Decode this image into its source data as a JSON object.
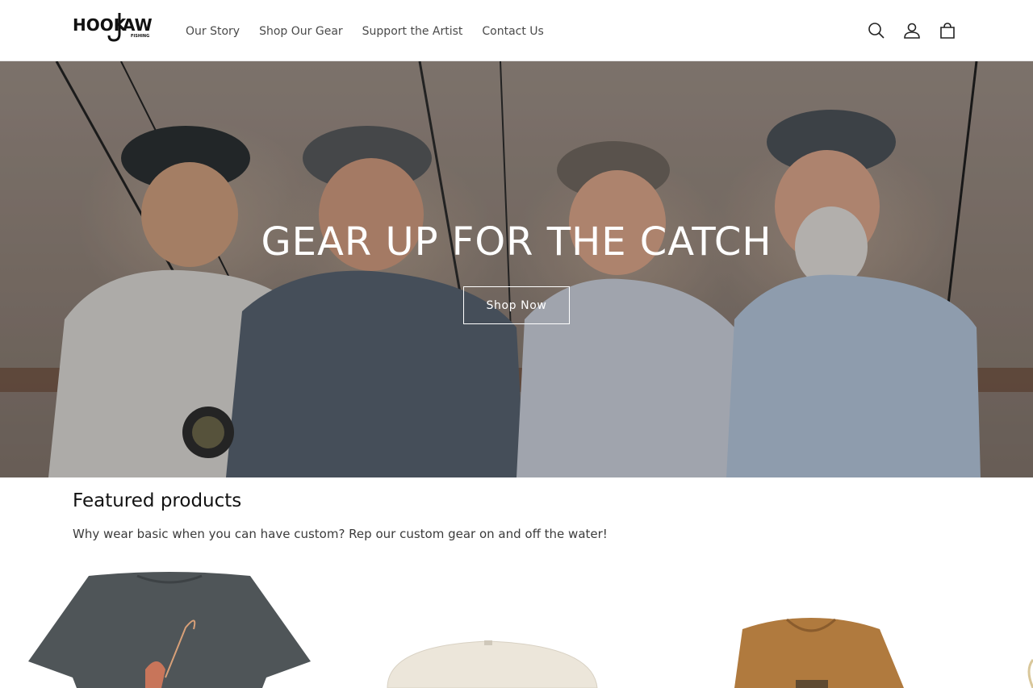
{
  "header": {
    "logo": {
      "main": "HOOK JAW",
      "sub": "FISHING"
    },
    "nav": [
      {
        "label": "Our Story"
      },
      {
        "label": "Shop Our Gear"
      },
      {
        "label": "Support the Artist"
      },
      {
        "label": "Contact Us"
      }
    ],
    "icons": [
      "search-icon",
      "account-icon",
      "cart-icon"
    ]
  },
  "hero": {
    "title": "GEAR UP FOR THE CATCH",
    "button_label": "Shop Now"
  },
  "featured": {
    "title": "Featured products",
    "description": "Why wear basic when you can have custom? Rep our custom gear on and off the water!",
    "products": [
      {
        "type": "t-shirt",
        "color": "#4f5558"
      },
      {
        "type": "cap",
        "color": "#ece6da"
      },
      {
        "type": "hoodie",
        "color": "#b07a3e"
      }
    ]
  },
  "colors": {
    "text": "#121212",
    "nav_text": "#4a4a4a",
    "border": "#e6e6e6"
  }
}
